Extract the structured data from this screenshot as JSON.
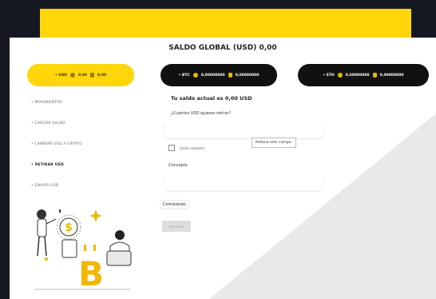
{
  "page": {
    "title": "SALDO GLOBAL (USD) 0,00"
  },
  "balances": {
    "usd": {
      "label": "• USD",
      "amount_1": "0,00",
      "amount_2": "0,00"
    },
    "btc": {
      "label": "• BTC",
      "amount_1": "0,00000000",
      "amount_2": "0,00000000"
    },
    "eth": {
      "label": "• ETH",
      "amount_1": "0,00000000",
      "amount_2": "0,00000000"
    }
  },
  "menu": {
    "items": [
      {
        "label": "• MOVIMIENTOS"
      },
      {
        "label": "• CARGAR SALDO"
      },
      {
        "label": "• CAMBIAR USD A CRYPTO"
      },
      {
        "label": "• RETIRAR USD",
        "active": true
      },
      {
        "label": "• ENVIAR USD"
      }
    ]
  },
  "form": {
    "current_balance": "Tu saldo actual es 0,00 USD",
    "question": "¿Cuántos USD quieres retirar?",
    "amount_value": "",
    "tooltip": "Rellene este campo.",
    "checkbox_label": "Saldo completo",
    "concept_label": "Concepto",
    "concept_value": "",
    "commissions_label": "Comisiones",
    "submit_label": "RETIRAR"
  },
  "colors": {
    "accent": "#ffd60a",
    "dark": "#111111",
    "background": "#151820",
    "panel": "#f4f4f4"
  },
  "icons": [
    "btc-coin-icon",
    "wallet-bag-icon",
    "dollar-coin-icon",
    "bitcoin-symbol-icon"
  ]
}
